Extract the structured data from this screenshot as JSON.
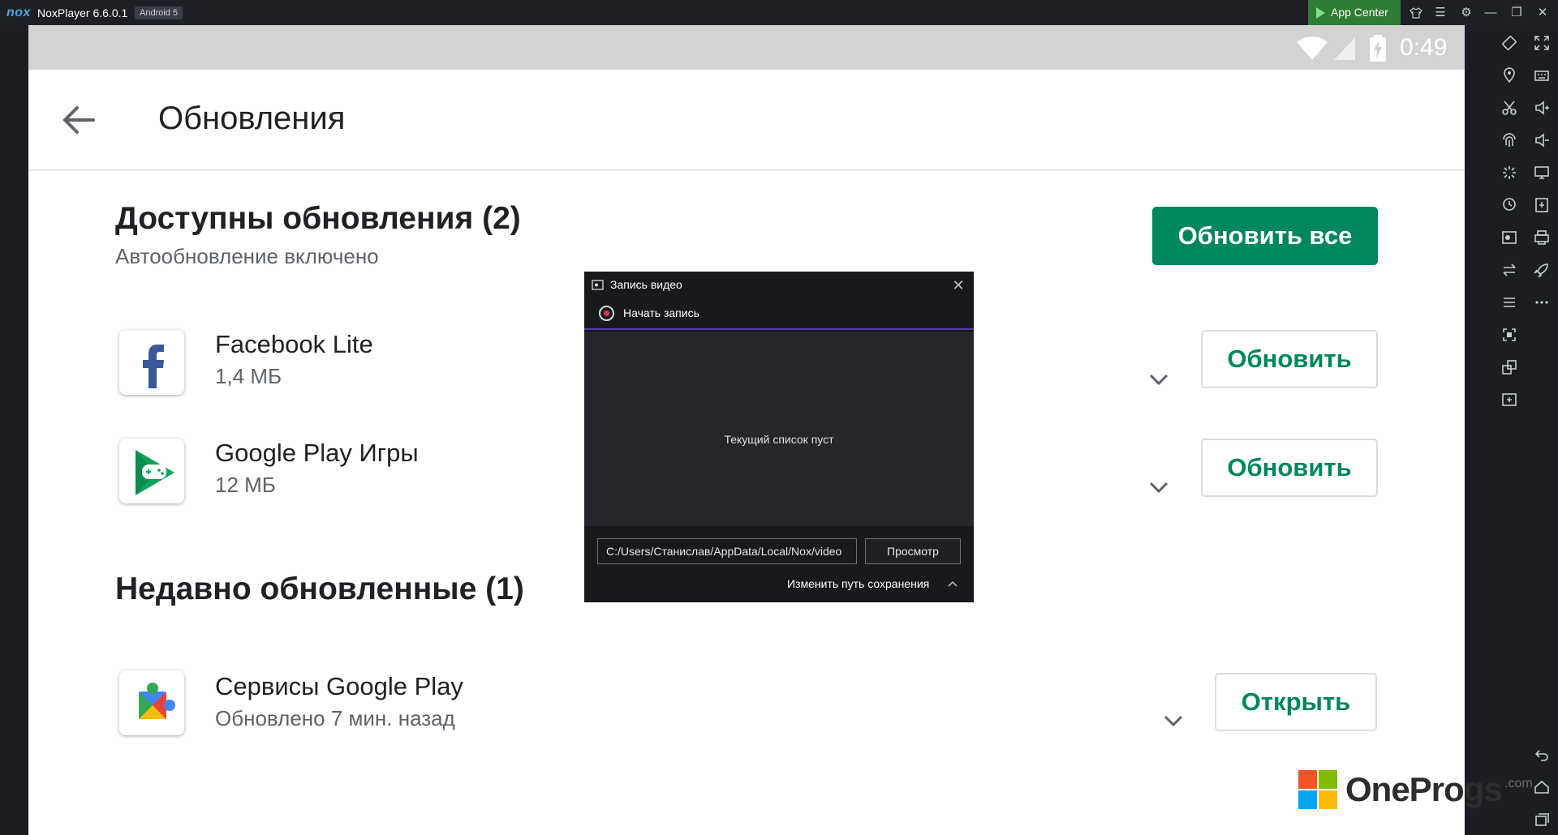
{
  "window": {
    "logo": "nox",
    "app_name": "NoxPlayer 6.6.0.1",
    "android_badge": "Android 5",
    "app_center_label": "App Center"
  },
  "status_bar": {
    "time": "0:49",
    "icons": [
      "wifi-icon",
      "signal-icon",
      "battery-charging-icon"
    ]
  },
  "app_bar": {
    "title": "Обновления",
    "back_icon": "arrow-left-icon"
  },
  "available": {
    "title": "Доступны обновления (2)",
    "subtitle": "Автообновление включено",
    "update_all_label": "Обновить все",
    "apps": [
      {
        "name": "Facebook Lite",
        "meta": "1,4 МБ",
        "action": "Обновить"
      },
      {
        "name": "Google Play Игры",
        "meta": "12 МБ",
        "action": "Обновить"
      }
    ]
  },
  "recent": {
    "title": "Недавно обновленные (1)",
    "apps": [
      {
        "name": "Сервисы Google Play",
        "meta": "Обновлено 7 мин. назад",
        "action": "Открыть"
      }
    ]
  },
  "rec_dialog": {
    "title": "Запись видео",
    "start_label": "Начать запись",
    "empty_text": "Текущий список пуст",
    "path_value": "C:/Users/Станислав/AppData/Local/Nox/video",
    "browse_label": "Просмотр",
    "change_path_label": "Изменить путь сохранения"
  },
  "watermark": {
    "brand": "OneProgs",
    "suffix": ".com"
  },
  "colors": {
    "play_green": "#01875f",
    "nox_bg": "#1b1d22",
    "status_gray": "#d3d3d3",
    "rec_accent": "#5a3aa8"
  }
}
